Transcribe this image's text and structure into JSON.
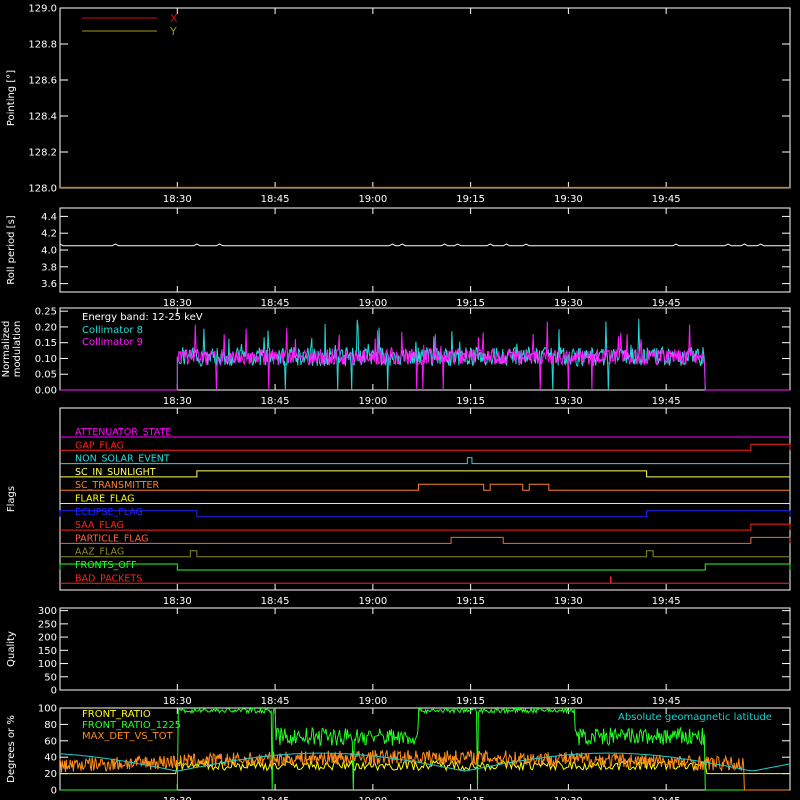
{
  "time_ticks": [
    "18:30",
    "18:45",
    "19:00",
    "19:15",
    "19:30",
    "19:45"
  ],
  "time_ticks_min": [
    30,
    45,
    60,
    75,
    90,
    105
  ],
  "time_range_min": [
    12,
    124
  ],
  "colors": {
    "axis": "#ffffff",
    "x_series": "#d01010",
    "y_series": "#9a9a18",
    "collimator8": "#22d8d8",
    "collimator9": "#ff1aff",
    "front_ratio": "#ffff00",
    "front_ratio_1225": "#22ff22",
    "max_det_vs_tot": "#ff8c1a",
    "geomag_lat": "#22cccc"
  },
  "chart_data": [
    {
      "type": "line",
      "name_key": "pointing",
      "ylabel": "Pointing [°]",
      "yticks": [
        "128.0",
        "128.2",
        "128.4",
        "128.6",
        "128.8",
        "129.0"
      ],
      "ylim": [
        128.0,
        129.0
      ],
      "legend": [
        {
          "label": "X",
          "color": "#d01010"
        },
        {
          "label": "Y",
          "color": "#9a9a18"
        }
      ],
      "series": [
        {
          "name": "X",
          "x": [
            12,
            124
          ],
          "values": [
            128.0,
            128.0
          ]
        },
        {
          "name": "Y",
          "x": [
            12,
            124
          ],
          "values": [
            128.0,
            128.0
          ]
        }
      ]
    },
    {
      "type": "line",
      "name_key": "roll",
      "ylabel": "Roll period [s]",
      "yticks": [
        "3.6",
        "3.8",
        "4.0",
        "4.2",
        "4.4"
      ],
      "ylim": [
        3.5,
        4.5
      ],
      "series": [
        {
          "name": "roll",
          "x": [
            12,
            124
          ],
          "values": [
            4.05,
            4.05
          ]
        }
      ]
    },
    {
      "type": "line",
      "name_key": "modulation",
      "ylabel": "Normalized modulation",
      "yticks": [
        "0.00",
        "0.05",
        "0.10",
        "0.15",
        "0.20",
        "0.25"
      ],
      "ylim": [
        0,
        0.26
      ],
      "annotation": "Energy band: 12-25 keV",
      "legend": [
        {
          "label": "Collimator 8",
          "color": "#22d8d8"
        },
        {
          "label": "Collimator 9",
          "color": "#ff1aff"
        }
      ],
      "active_range_min": [
        30,
        111
      ],
      "baseline": 0.1
    },
    {
      "type": "line",
      "name_key": "flags",
      "ylabel": "Flags",
      "flags": [
        {
          "label": "ATTENUATOR_STATE",
          "color": "#ff00ff",
          "steps": []
        },
        {
          "label": "GAP_FLAG",
          "color": "#ff2020",
          "steps": [
            [
              118,
              124
            ]
          ]
        },
        {
          "label": "NON_SOLAR_EVENT",
          "color": "#22dddd",
          "steps": [
            [
              74.5,
              75.2
            ]
          ]
        },
        {
          "label": "SC_IN_SUNLIGHT",
          "color": "#ffff55",
          "steps": [
            [
              33,
              102
            ]
          ]
        },
        {
          "label": "SC_TRANSMITTER",
          "color": "#ff8030",
          "steps": [
            [
              67,
              77
            ],
            [
              78,
              83
            ],
            [
              84,
              87
            ]
          ]
        },
        {
          "label": "FLARE_FLAG",
          "color": "#ffff00",
          "steps": []
        },
        {
          "label": "ECLIPSE_FLAG",
          "color": "#2222ff",
          "steps": [
            [
              12,
              33
            ],
            [
              102,
              124
            ]
          ]
        },
        {
          "label": "SAA_FLAG",
          "color": "#ff2020",
          "steps": [
            [
              118,
              124
            ]
          ]
        },
        {
          "label": "PARTICLE_FLAG",
          "color": "#ff6040",
          "steps": [
            [
              72,
              80
            ],
            [
              118,
              124
            ]
          ]
        },
        {
          "label": "AAZ_FLAG",
          "color": "#8a8a22",
          "steps": [
            [
              32,
              33
            ],
            [
              102,
              103
            ]
          ]
        },
        {
          "label": "FRONTS_OFF",
          "color": "#22ff22",
          "steps": [
            [
              12,
              30
            ],
            [
              111,
              124
            ]
          ]
        },
        {
          "label": "BAD_PACKETS",
          "color": "#ff2020",
          "spikes": [
            96.5
          ]
        }
      ]
    },
    {
      "type": "line",
      "name_key": "quality",
      "ylabel": "Quality",
      "yticks": [
        "0",
        "50",
        "100",
        "150",
        "200",
        "250",
        "300"
      ],
      "ylim": [
        0,
        310
      ]
    },
    {
      "type": "line",
      "name_key": "ratios",
      "ylabel": "Degrees or %",
      "yticks": [
        "0",
        "20",
        "40",
        "60",
        "80",
        "100"
      ],
      "ylim": [
        0,
        100
      ],
      "legend": [
        {
          "label": "FRONT_RATIO",
          "color": "#ffff00"
        },
        {
          "label": "FRONT_RATIO_1225",
          "color": "#22ff22"
        },
        {
          "label": "MAX_DET_VS_TOT",
          "color": "#ff8c1a"
        }
      ],
      "annotation": "Absolute geomagnetic latitude"
    }
  ]
}
